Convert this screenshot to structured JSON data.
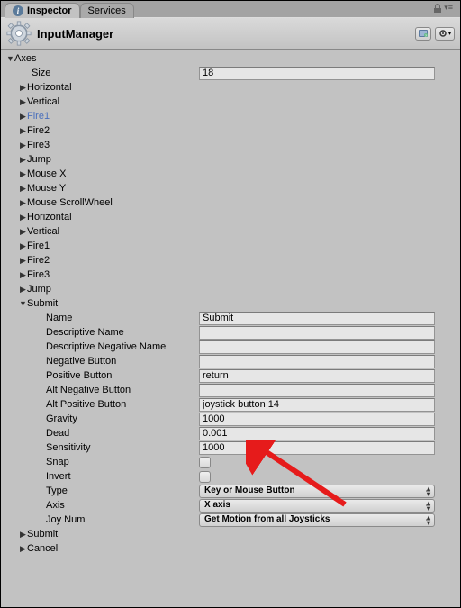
{
  "tabs": {
    "inspector": "Inspector",
    "services": "Services"
  },
  "header": {
    "title": "InputManager"
  },
  "axes": {
    "label": "Axes",
    "size_label": "Size",
    "size_value": "18",
    "items": [
      "Horizontal",
      "Vertical",
      "Fire1",
      "Fire2",
      "Fire3",
      "Jump",
      "Mouse X",
      "Mouse Y",
      "Mouse ScrollWheel",
      "Horizontal",
      "Vertical",
      "Fire1",
      "Fire2",
      "Fire3",
      "Jump",
      "Submit",
      "Submit",
      "Cancel"
    ],
    "selected_index": 2,
    "expanded_index": 15
  },
  "submit": {
    "name_label": "Name",
    "name_value": "Submit",
    "desc_name_label": "Descriptive Name",
    "desc_name_value": "",
    "desc_neg_label": "Descriptive Negative Name",
    "desc_neg_value": "",
    "neg_btn_label": "Negative Button",
    "neg_btn_value": "",
    "pos_btn_label": "Positive Button",
    "pos_btn_value": "return",
    "alt_neg_label": "Alt Negative Button",
    "alt_neg_value": "",
    "alt_pos_label": "Alt Positive Button",
    "alt_pos_value": "joystick button 14",
    "gravity_label": "Gravity",
    "gravity_value": "1000",
    "dead_label": "Dead",
    "dead_value": "0.001",
    "sensitivity_label": "Sensitivity",
    "sensitivity_value": "1000",
    "snap_label": "Snap",
    "snap_value": false,
    "invert_label": "Invert",
    "invert_value": false,
    "type_label": "Type",
    "type_value": "Key or Mouse Button",
    "axis_label": "Axis",
    "axis_value": "X axis",
    "joynum_label": "Joy Num",
    "joynum_value": "Get Motion from all Joysticks"
  }
}
